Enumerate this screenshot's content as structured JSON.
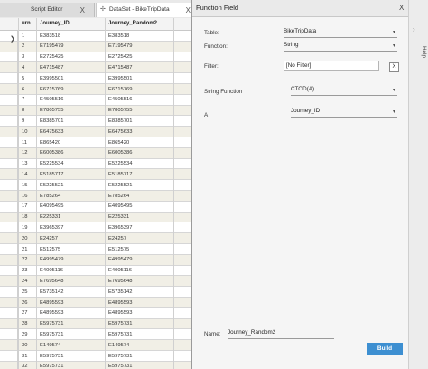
{
  "tabs": [
    {
      "label": "Script Editor",
      "close": "X"
    },
    {
      "label": "DataSet - BikeTripData",
      "close": "X"
    }
  ],
  "grid": {
    "columns": [
      "urn",
      "Journey_ID",
      "Journey_Random2"
    ],
    "rows": [
      [
        "1",
        "E383518",
        "E383518"
      ],
      [
        "2",
        "E7195479",
        "E7195479"
      ],
      [
        "3",
        "E2725425",
        "E2725425"
      ],
      [
        "4",
        "E4715487",
        "E4715487"
      ],
      [
        "5",
        "E3995501",
        "E3995501"
      ],
      [
        "6",
        "E6715769",
        "E6715769"
      ],
      [
        "7",
        "E4505516",
        "E4505516"
      ],
      [
        "8",
        "E7805755",
        "E7805755"
      ],
      [
        "9",
        "E8385701",
        "E8385701"
      ],
      [
        "10",
        "E6475633",
        "E6475633"
      ],
      [
        "11",
        "E865420",
        "E865420"
      ],
      [
        "12",
        "E6005386",
        "E6005386"
      ],
      [
        "13",
        "E5225534",
        "E5225534"
      ],
      [
        "14",
        "E5185717",
        "E5185717"
      ],
      [
        "15",
        "E5225521",
        "E5225521"
      ],
      [
        "16",
        "E785264",
        "E785264"
      ],
      [
        "17",
        "E4095495",
        "E4095495"
      ],
      [
        "18",
        "E225331",
        "E225331"
      ],
      [
        "19",
        "E3965397",
        "E3965397"
      ],
      [
        "20",
        "E24257",
        "E24257"
      ],
      [
        "21",
        "E512575",
        "E512575"
      ],
      [
        "22",
        "E4995479",
        "E4995479"
      ],
      [
        "23",
        "E4005116",
        "E4005116"
      ],
      [
        "24",
        "E7695648",
        "E7695648"
      ],
      [
        "25",
        "E5735142",
        "E5735142"
      ],
      [
        "26",
        "E4895593",
        "E4895593"
      ],
      [
        "27",
        "E4895593",
        "E4895593"
      ],
      [
        "28",
        "E5975731",
        "E5975731"
      ],
      [
        "29",
        "E5975731",
        "E5975731"
      ],
      [
        "30",
        "E149574",
        "E149574"
      ],
      [
        "31",
        "E5975731",
        "E5975731"
      ],
      [
        "32",
        "E5975731",
        "E5975731"
      ]
    ]
  },
  "panel": {
    "title": "Function Field",
    "close": "X",
    "table_label": "Table:",
    "table_value": "BikeTripData",
    "function_label": "Function:",
    "function_value": "String",
    "filter_label": "Filter:",
    "filter_value": "[No Filter]",
    "filter_clear": "X",
    "string_function_label": "String Function",
    "string_function_value": "CTOD(A)",
    "a_label": "A",
    "a_value": "Journey_ID",
    "name_label": "Name:",
    "name_value": "Journey_Random2",
    "build_label": "Build",
    "help_label": "Help",
    "chevron": "›"
  }
}
